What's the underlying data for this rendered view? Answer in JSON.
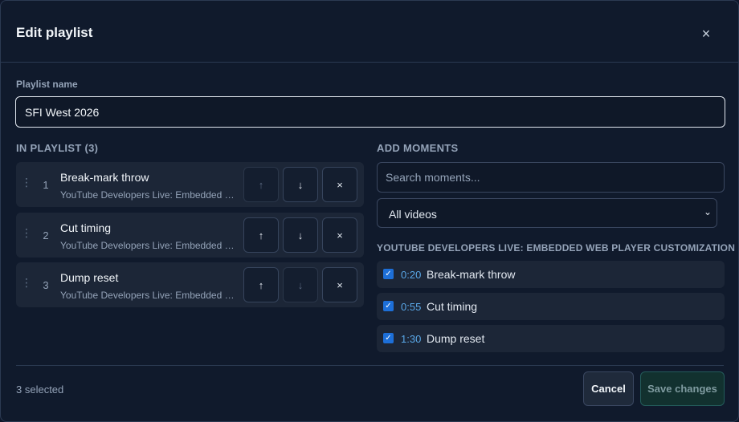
{
  "dialog": {
    "title": "Edit playlist",
    "close_glyph": "×"
  },
  "playlist_name": {
    "label": "Playlist name",
    "value": "SFI West 2026"
  },
  "in_playlist": {
    "heading": "IN PLAYLIST (3)",
    "items": [
      {
        "index": "1",
        "title": "Break-mark throw",
        "source": "YouTube Developers Live: Embedded Web Player Customization",
        "up_enabled": false,
        "down_enabled": true
      },
      {
        "index": "2",
        "title": "Cut timing",
        "source": "YouTube Developers Live: Embedded Web Player Customization",
        "up_enabled": true,
        "down_enabled": true
      },
      {
        "index": "3",
        "title": "Dump reset",
        "source": "YouTube Developers Live: Embedded Web Player Customization",
        "up_enabled": true,
        "down_enabled": false
      }
    ],
    "drag_glyph": "⋮",
    "up_glyph": "↑",
    "down_glyph": "↓",
    "remove_glyph": "×"
  },
  "add_moments": {
    "heading": "ADD MOMENTS",
    "search_placeholder": "Search moments...",
    "filter_selected": "All videos",
    "group_title": "YOUTUBE DEVELOPERS LIVE: EMBEDDED WEB PLAYER CUSTOMIZATION",
    "moments": [
      {
        "time": "0:20",
        "title": "Break-mark throw",
        "checked": true
      },
      {
        "time": "0:55",
        "title": "Cut timing",
        "checked": true
      },
      {
        "time": "1:30",
        "title": "Dump reset",
        "checked": true
      }
    ]
  },
  "footer": {
    "selected_count": "3 selected",
    "cancel_label": "Cancel",
    "save_label": "Save changes"
  },
  "colors": {
    "accent_time": "#5aa8e8",
    "checkbox": "#1d6fd8",
    "save_bg": "#12312f"
  },
  "icons": {
    "close": "close-icon",
    "drag": "drag-handle-icon",
    "up": "arrow-up-icon",
    "down": "arrow-down-icon",
    "remove": "remove-icon",
    "caret": "chevron-down-icon",
    "check": "checkmark-icon"
  }
}
